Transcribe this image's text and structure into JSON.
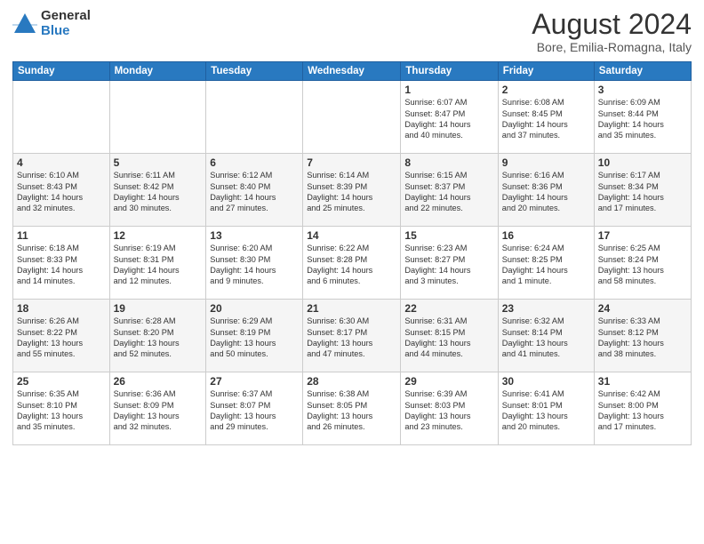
{
  "logo": {
    "general": "General",
    "blue": "Blue"
  },
  "title": "August 2024",
  "subtitle": "Bore, Emilia-Romagna, Italy",
  "headers": [
    "Sunday",
    "Monday",
    "Tuesday",
    "Wednesday",
    "Thursday",
    "Friday",
    "Saturday"
  ],
  "weeks": [
    [
      {
        "day": "",
        "info": ""
      },
      {
        "day": "",
        "info": ""
      },
      {
        "day": "",
        "info": ""
      },
      {
        "day": "",
        "info": ""
      },
      {
        "day": "1",
        "info": "Sunrise: 6:07 AM\nSunset: 8:47 PM\nDaylight: 14 hours\nand 40 minutes."
      },
      {
        "day": "2",
        "info": "Sunrise: 6:08 AM\nSunset: 8:45 PM\nDaylight: 14 hours\nand 37 minutes."
      },
      {
        "day": "3",
        "info": "Sunrise: 6:09 AM\nSunset: 8:44 PM\nDaylight: 14 hours\nand 35 minutes."
      }
    ],
    [
      {
        "day": "4",
        "info": "Sunrise: 6:10 AM\nSunset: 8:43 PM\nDaylight: 14 hours\nand 32 minutes."
      },
      {
        "day": "5",
        "info": "Sunrise: 6:11 AM\nSunset: 8:42 PM\nDaylight: 14 hours\nand 30 minutes."
      },
      {
        "day": "6",
        "info": "Sunrise: 6:12 AM\nSunset: 8:40 PM\nDaylight: 14 hours\nand 27 minutes."
      },
      {
        "day": "7",
        "info": "Sunrise: 6:14 AM\nSunset: 8:39 PM\nDaylight: 14 hours\nand 25 minutes."
      },
      {
        "day": "8",
        "info": "Sunrise: 6:15 AM\nSunset: 8:37 PM\nDaylight: 14 hours\nand 22 minutes."
      },
      {
        "day": "9",
        "info": "Sunrise: 6:16 AM\nSunset: 8:36 PM\nDaylight: 14 hours\nand 20 minutes."
      },
      {
        "day": "10",
        "info": "Sunrise: 6:17 AM\nSunset: 8:34 PM\nDaylight: 14 hours\nand 17 minutes."
      }
    ],
    [
      {
        "day": "11",
        "info": "Sunrise: 6:18 AM\nSunset: 8:33 PM\nDaylight: 14 hours\nand 14 minutes."
      },
      {
        "day": "12",
        "info": "Sunrise: 6:19 AM\nSunset: 8:31 PM\nDaylight: 14 hours\nand 12 minutes."
      },
      {
        "day": "13",
        "info": "Sunrise: 6:20 AM\nSunset: 8:30 PM\nDaylight: 14 hours\nand 9 minutes."
      },
      {
        "day": "14",
        "info": "Sunrise: 6:22 AM\nSunset: 8:28 PM\nDaylight: 14 hours\nand 6 minutes."
      },
      {
        "day": "15",
        "info": "Sunrise: 6:23 AM\nSunset: 8:27 PM\nDaylight: 14 hours\nand 3 minutes."
      },
      {
        "day": "16",
        "info": "Sunrise: 6:24 AM\nSunset: 8:25 PM\nDaylight: 14 hours\nand 1 minute."
      },
      {
        "day": "17",
        "info": "Sunrise: 6:25 AM\nSunset: 8:24 PM\nDaylight: 13 hours\nand 58 minutes."
      }
    ],
    [
      {
        "day": "18",
        "info": "Sunrise: 6:26 AM\nSunset: 8:22 PM\nDaylight: 13 hours\nand 55 minutes."
      },
      {
        "day": "19",
        "info": "Sunrise: 6:28 AM\nSunset: 8:20 PM\nDaylight: 13 hours\nand 52 minutes."
      },
      {
        "day": "20",
        "info": "Sunrise: 6:29 AM\nSunset: 8:19 PM\nDaylight: 13 hours\nand 50 minutes."
      },
      {
        "day": "21",
        "info": "Sunrise: 6:30 AM\nSunset: 8:17 PM\nDaylight: 13 hours\nand 47 minutes."
      },
      {
        "day": "22",
        "info": "Sunrise: 6:31 AM\nSunset: 8:15 PM\nDaylight: 13 hours\nand 44 minutes."
      },
      {
        "day": "23",
        "info": "Sunrise: 6:32 AM\nSunset: 8:14 PM\nDaylight: 13 hours\nand 41 minutes."
      },
      {
        "day": "24",
        "info": "Sunrise: 6:33 AM\nSunset: 8:12 PM\nDaylight: 13 hours\nand 38 minutes."
      }
    ],
    [
      {
        "day": "25",
        "info": "Sunrise: 6:35 AM\nSunset: 8:10 PM\nDaylight: 13 hours\nand 35 minutes."
      },
      {
        "day": "26",
        "info": "Sunrise: 6:36 AM\nSunset: 8:09 PM\nDaylight: 13 hours\nand 32 minutes."
      },
      {
        "day": "27",
        "info": "Sunrise: 6:37 AM\nSunset: 8:07 PM\nDaylight: 13 hours\nand 29 minutes."
      },
      {
        "day": "28",
        "info": "Sunrise: 6:38 AM\nSunset: 8:05 PM\nDaylight: 13 hours\nand 26 minutes."
      },
      {
        "day": "29",
        "info": "Sunrise: 6:39 AM\nSunset: 8:03 PM\nDaylight: 13 hours\nand 23 minutes."
      },
      {
        "day": "30",
        "info": "Sunrise: 6:41 AM\nSunset: 8:01 PM\nDaylight: 13 hours\nand 20 minutes."
      },
      {
        "day": "31",
        "info": "Sunrise: 6:42 AM\nSunset: 8:00 PM\nDaylight: 13 hours\nand 17 minutes."
      }
    ]
  ]
}
